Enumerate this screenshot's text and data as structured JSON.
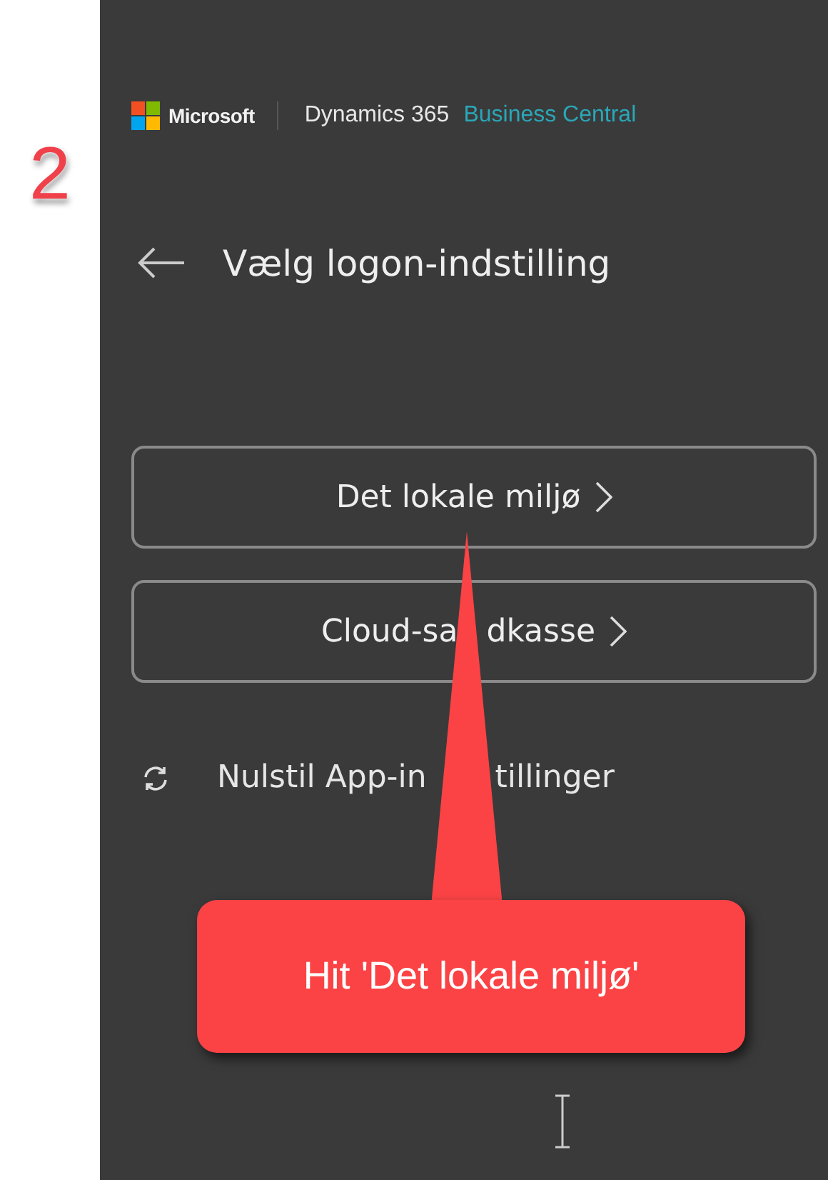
{
  "step_number": "2",
  "header": {
    "brand": "Microsoft",
    "product": "Dynamics 365",
    "product_edition": "Business Central"
  },
  "title": "Vælg logon-indstilling",
  "options": [
    {
      "label_parts": [
        "Det lokale miljø"
      ]
    },
    {
      "label_parts": [
        "Cloud-sa",
        "dkasse"
      ]
    }
  ],
  "reset_link_parts": [
    "Nulstil App-in",
    "tillinger"
  ],
  "callout": "Hit 'Det lokale miljø'"
}
